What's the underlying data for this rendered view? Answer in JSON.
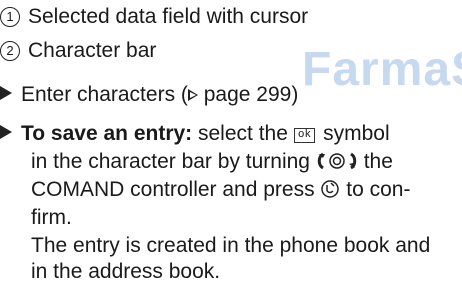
{
  "watermark": "FarmaS",
  "list": [
    {
      "num": "1",
      "text": "Selected data field with cursor"
    },
    {
      "num": "2",
      "text": "Character bar"
    }
  ],
  "step1": {
    "before": "Enter characters (",
    "page_ref": "page 299",
    "after": ")"
  },
  "step2": {
    "bold": "To save an entry:",
    "text_a": " select the",
    "ok_symbol": "ok",
    "text_b": "symbol",
    "line2_a": "in the character bar by turning",
    "line2_b": "the",
    "line3_a": "COMAND controller and press",
    "line3_b": "to con-",
    "line4": "firm.",
    "result_line1": "The entry is created in the phone book and",
    "result_line2": "in the address book."
  }
}
